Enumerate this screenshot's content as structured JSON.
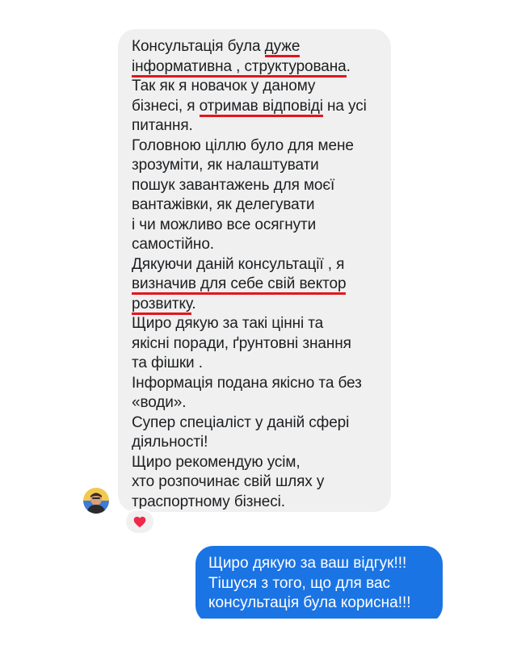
{
  "conversation": {
    "incoming_message": {
      "lines": [
        {
          "parts": [
            {
              "text": "Консультація була "
            },
            {
              "text": "дуже",
              "underline": true
            }
          ]
        },
        {
          "parts": [
            {
              "text": "інформативна , структурована",
              "underline": true
            },
            {
              "text": "."
            }
          ]
        },
        {
          "parts": [
            {
              "text": "Так як я новачок у даному"
            }
          ]
        },
        {
          "parts": [
            {
              "text": "бізнесі, я "
            },
            {
              "text": "отримав відповіді",
              "underline": true
            },
            {
              "text": " на усі"
            }
          ]
        },
        {
          "parts": [
            {
              "text": "питання."
            }
          ]
        },
        {
          "parts": [
            {
              "text": "Головною ціллю було для мене"
            }
          ]
        },
        {
          "parts": [
            {
              "text": "зрозуміти, як налаштувати"
            }
          ]
        },
        {
          "parts": [
            {
              "text": "пошук завантажень для моєї"
            }
          ]
        },
        {
          "parts": [
            {
              "text": "вантажівки, як делегувати"
            }
          ]
        },
        {
          "parts": [
            {
              "text": "і чи можливо все осягнути"
            }
          ]
        },
        {
          "parts": [
            {
              "text": "самостійно."
            }
          ]
        },
        {
          "parts": [
            {
              "text": "Дякуючи даній консультації , я"
            }
          ]
        },
        {
          "parts": [
            {
              "text": "визначив для себе свій вектор",
              "underline": true
            }
          ]
        },
        {
          "parts": [
            {
              "text": "розвитку",
              "underline": true
            },
            {
              "text": "."
            }
          ]
        },
        {
          "parts": [
            {
              "text": "Щиро дякую за такі цінні та"
            }
          ]
        },
        {
          "parts": [
            {
              "text": "якісні поради, ґрунтовні знання"
            }
          ]
        },
        {
          "parts": [
            {
              "text": "та фішки ."
            }
          ]
        },
        {
          "parts": [
            {
              "text": "Інформація подана якісно та без"
            }
          ]
        },
        {
          "parts": [
            {
              "text": "«води»."
            }
          ]
        },
        {
          "parts": [
            {
              "text": "Супер спеціаліст у даній сфері"
            }
          ]
        },
        {
          "parts": [
            {
              "text": "діяльності!"
            }
          ]
        },
        {
          "parts": [
            {
              "text": "Щиро рекомендую усім,"
            }
          ]
        },
        {
          "parts": [
            {
              "text": "хто розпочинає свій шлях у"
            }
          ]
        },
        {
          "parts": [
            {
              "text": "траспортному бізнесі."
            }
          ]
        }
      ],
      "reaction_icon": "heart-icon",
      "sender_avatar_icon": "avatar"
    },
    "outgoing_message": {
      "lines": [
        "Щиро дякую за ваш відгук!!!",
        "Тішуся з того, що для вас",
        "консультація була корисна!!!"
      ]
    },
    "colors": {
      "incoming_bubble": "#f0f0f0",
      "outgoing_bubble": "#1b74e4",
      "highlight_underline": "#e3151e",
      "reaction_heart": "#f0284a"
    }
  }
}
